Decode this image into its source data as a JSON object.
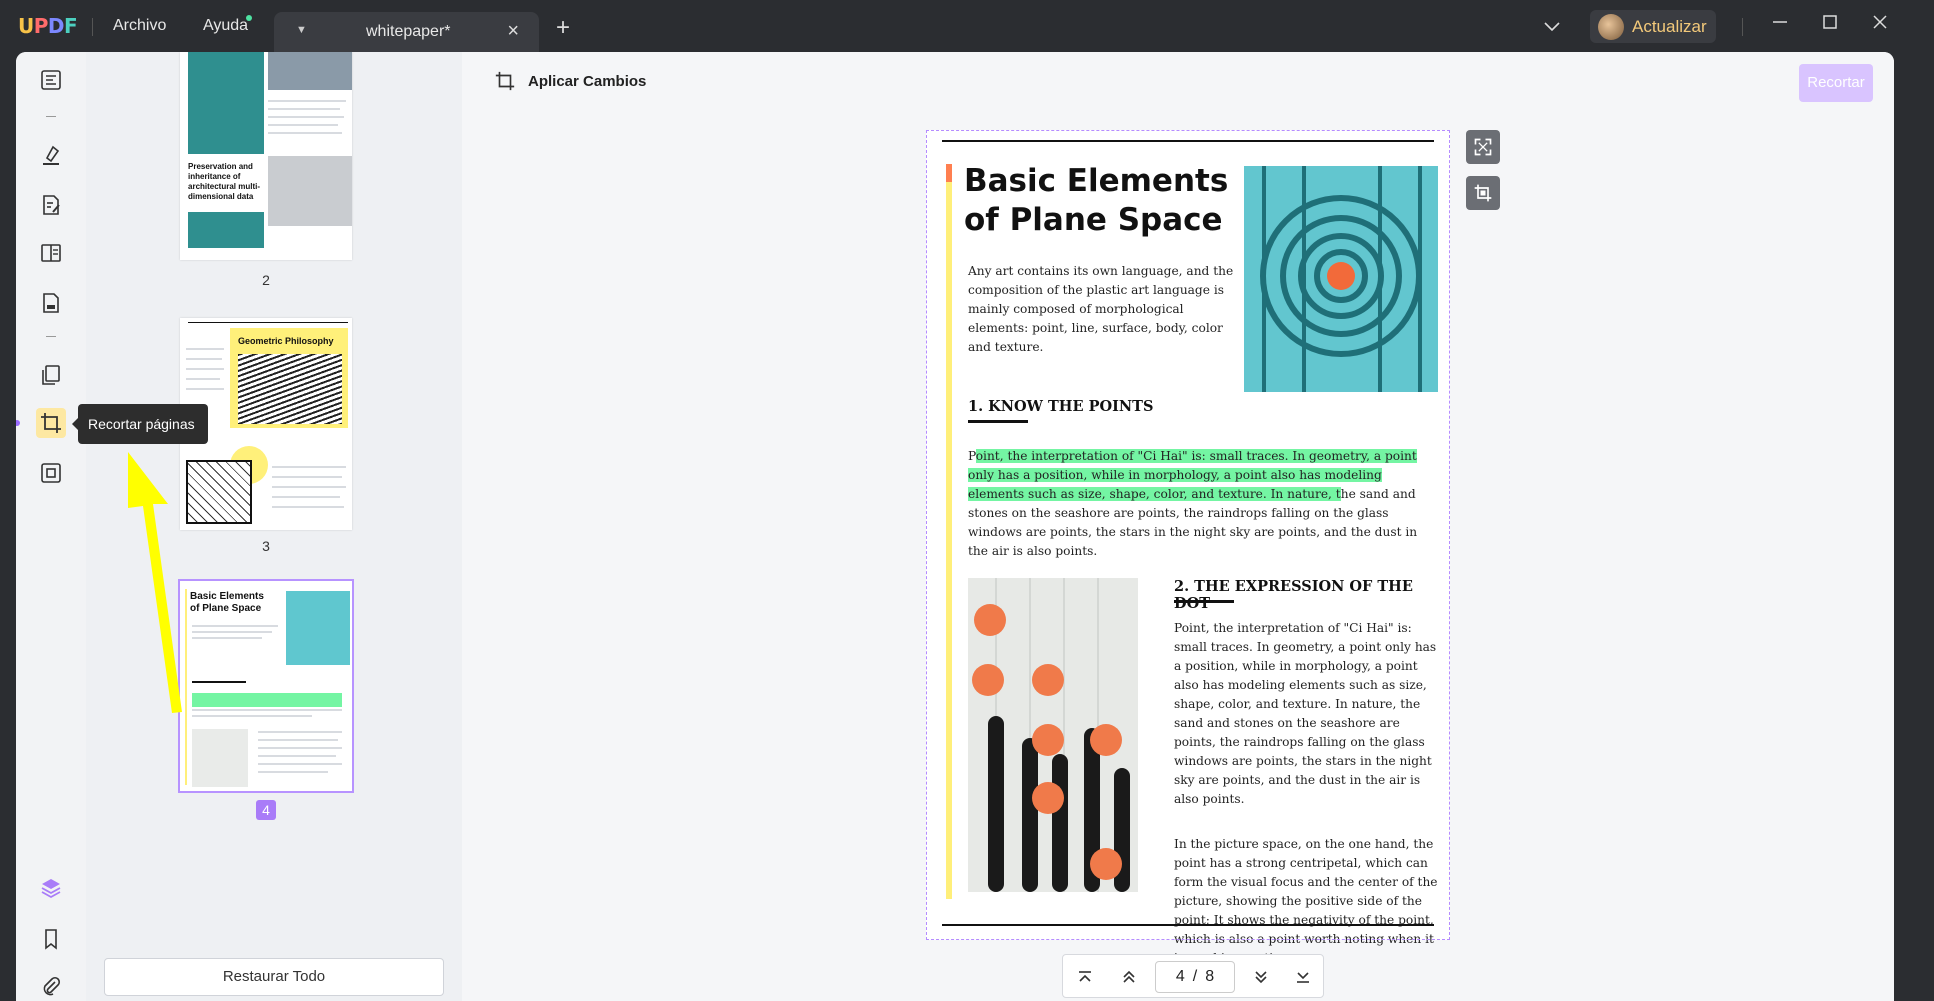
{
  "app": {
    "logo": "UPDF",
    "menu": {
      "file": "Archivo",
      "help": "Ayuda"
    },
    "tab": {
      "title": "whitepaper*"
    },
    "upgrade_label": "Actualizar"
  },
  "toolbar": {
    "apply_label": "Aplicar Cambios",
    "crop_label": "Recortar"
  },
  "tooltip": {
    "text": "Recortar páginas"
  },
  "sidebar": {
    "icons": [
      "reader-icon",
      "highlighter-icon",
      "edit-pdf-icon",
      "form-icon",
      "sign-icon",
      "organize-pages-icon",
      "crop-pages-icon",
      "compress-icon",
      "layers-icon",
      "bookmark-icon",
      "attachment-icon"
    ],
    "active": "crop-pages-icon"
  },
  "thumbnails": {
    "pages": [
      {
        "number": "2",
        "heading": "Preservation and inheritance of architectural multi-dimensional data"
      },
      {
        "number": "3",
        "heading": "Geometric Philosophy"
      },
      {
        "number": "4",
        "heading": "Basic Elements of Plane Space",
        "selected": true
      }
    ],
    "restore_label": "Restaurar Todo"
  },
  "document": {
    "title": "Basic Elements of Plane Space",
    "intro": "Any art contains its own language, and the composition of the plastic art language is mainly composed of morphological elements: point, line, surface, body, color and texture.",
    "section1": {
      "heading": "1. KNOW THE POINTS",
      "first_letter": "P",
      "highlighted": "oint, the interpretation of \"Ci Hai\" is: small traces. In geometry, a point only has a position, while in morphology, a point also has modeling elements such as size, shape, color, and texture. In nature, t",
      "rest": "he sand and stones on the seashore are points, the raindrops falling on the glass windows are points, the stars in the night sky are points, and the dust in the air is also points."
    },
    "section2": {
      "heading": "2. THE EXPRESSION OF THE DOT",
      "para1": "Point, the interpretation of \"Ci Hai\" is: small traces. In geometry, a point only has a position, while in morphology, a point also has modeling elements such as size, shape, color, and texture. In nature, the sand and stones on the seashore are points, the raindrops falling on the glass windows are points, the stars in the night sky are points, and the dust in the air is also points.",
      "para2": "In the picture space, on the one hand, the point has a strong centripetal, which can form the visual focus and the center of the picture, showing the positive side of the point; It shows the negativity of the point, which is also a point worth noting when it is used in practice."
    }
  },
  "pager": {
    "current": "4",
    "separator": "/",
    "total": "8"
  },
  "colors": {
    "accent": "#a97cf8",
    "highlight": "#74f5a3",
    "tooltip": "#2d2d2d",
    "arrow": "#ffff00"
  }
}
